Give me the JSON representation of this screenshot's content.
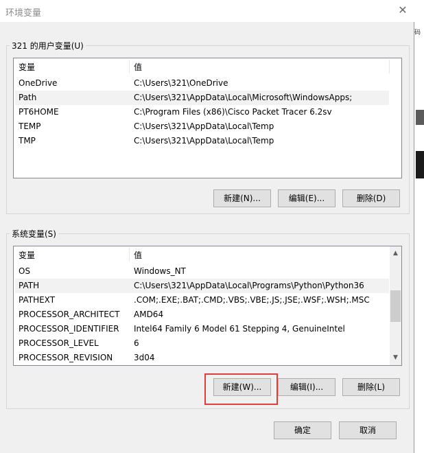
{
  "window": {
    "title": "环境变量",
    "close_symbol": "✕"
  },
  "user_section": {
    "label": "321 的用户变量(U)",
    "columns": [
      "变量",
      "值"
    ],
    "rows": [
      {
        "name": "OneDrive",
        "value": "C:\\Users\\321\\OneDrive"
      },
      {
        "name": "Path",
        "value": "C:\\Users\\321\\AppData\\Local\\Microsoft\\WindowsApps;"
      },
      {
        "name": "PT6HOME",
        "value": "C:\\Program Files (x86)\\Cisco Packet Tracer 6.2sv"
      },
      {
        "name": "TEMP",
        "value": "C:\\Users\\321\\AppData\\Local\\Temp"
      },
      {
        "name": "TMP",
        "value": "C:\\Users\\321\\AppData\\Local\\Temp"
      }
    ],
    "buttons": {
      "new": "新建(N)...",
      "edit": "编辑(E)...",
      "delete": "删除(D)"
    }
  },
  "system_section": {
    "label": "系统变量(S)",
    "columns": [
      "变量",
      "值"
    ],
    "rows": [
      {
        "name": "OS",
        "value": "Windows_NT"
      },
      {
        "name": "PATH",
        "value": "C:\\Users\\321\\AppData\\Local\\Programs\\Python\\Python36"
      },
      {
        "name": "PATHEXT",
        "value": ".COM;.EXE;.BAT;.CMD;.VBS;.VBE;.JS;.JSE;.WSF;.WSH;.MSC"
      },
      {
        "name": "PROCESSOR_ARCHITECT",
        "value": "AMD64"
      },
      {
        "name": "PROCESSOR_IDENTIFIER",
        "value": "Intel64 Family 6 Model 61 Stepping 4, GenuineIntel"
      },
      {
        "name": "PROCESSOR_LEVEL",
        "value": "6"
      },
      {
        "name": "PROCESSOR_REVISION",
        "value": "3d04"
      }
    ],
    "buttons": {
      "new": "新建(W)...",
      "edit": "编辑(I)...",
      "delete": "删除(L)"
    },
    "scroll_up": "▲",
    "scroll_down": "▼"
  },
  "footer": {
    "ok": "确定",
    "cancel": "取消"
  },
  "background_window": {
    "snippet": "码"
  }
}
